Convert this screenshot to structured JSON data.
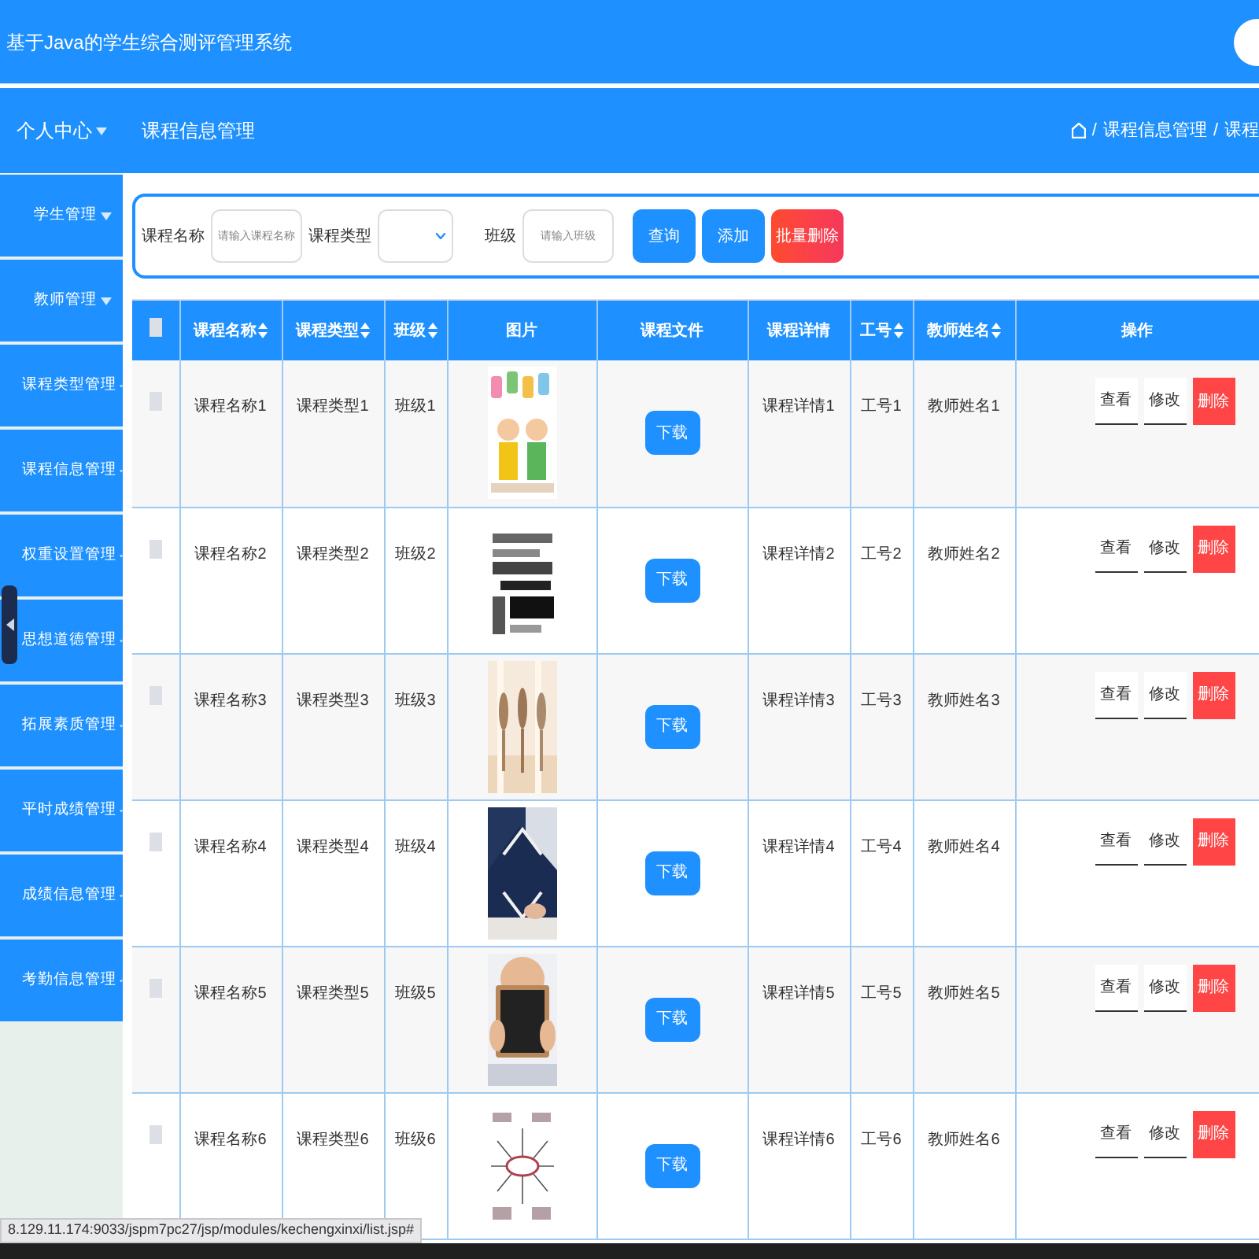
{
  "header": {
    "title": "基于Java的学生综合测评管理系统"
  },
  "nav": {
    "menu_label": "个人中心",
    "page_title": "课程信息管理",
    "breadcrumb": [
      {
        "separator": "/",
        "label": "课程信息管理"
      },
      {
        "separator": "/",
        "label": "课程"
      }
    ]
  },
  "sidebar": {
    "items": [
      {
        "label": "学生管理"
      },
      {
        "label": "教师管理"
      },
      {
        "label": "课程类型管理"
      },
      {
        "label": "课程信息管理"
      },
      {
        "label": "权重设置管理"
      },
      {
        "label": "思想道德管理"
      },
      {
        "label": "拓展素质管理"
      },
      {
        "label": "平时成绩管理"
      },
      {
        "label": "成绩信息管理"
      },
      {
        "label": "考勤信息管理"
      }
    ]
  },
  "search": {
    "fields": [
      {
        "kind": "input",
        "label": "课程名称",
        "placeholder": "请输入课程名称"
      },
      {
        "kind": "select",
        "label": "课程类型"
      },
      {
        "kind": "input",
        "label": "班级",
        "placeholder": "请输入班级"
      }
    ],
    "buttons": [
      {
        "label": "查询",
        "kind": "primary"
      },
      {
        "label": "添加",
        "kind": "primary"
      },
      {
        "label": "批量删除",
        "kind": "danger"
      }
    ]
  },
  "table": {
    "select_all": {
      "checked": false
    },
    "columns": [
      {
        "label": "课程名称",
        "sortable": true
      },
      {
        "label": "课程类型",
        "sortable": true
      },
      {
        "label": "班级",
        "sortable": true
      },
      {
        "label": "图片",
        "sortable": false
      },
      {
        "label": "课程文件",
        "sortable": false
      },
      {
        "label": "课程详情",
        "sortable": false
      },
      {
        "label": "工号",
        "sortable": true
      },
      {
        "label": "教师姓名",
        "sortable": true
      },
      {
        "label": "操作",
        "sortable": false
      }
    ],
    "rows": [
      {
        "checked": false,
        "cells": [
          "课程名称1",
          "课程类型1",
          "班级1"
        ],
        "file_button": "下载",
        "details": [
          "课程详情1",
          "工号1",
          "教师姓名1"
        ],
        "actions": [
          "查看",
          "修改",
          "删除"
        ]
      },
      {
        "checked": false,
        "cells": [
          "课程名称2",
          "课程类型2",
          "班级2"
        ],
        "file_button": "下载",
        "details": [
          "课程详情2",
          "工号2",
          "教师姓名2"
        ],
        "actions": [
          "查看",
          "修改",
          "删除"
        ]
      },
      {
        "checked": false,
        "cells": [
          "课程名称3",
          "课程类型3",
          "班级3"
        ],
        "file_button": "下载",
        "details": [
          "课程详情3",
          "工号3",
          "教师姓名3"
        ],
        "actions": [
          "查看",
          "修改",
          "删除"
        ]
      },
      {
        "checked": false,
        "cells": [
          "课程名称4",
          "课程类型4",
          "班级4"
        ],
        "file_button": "下载",
        "details": [
          "课程详情4",
          "工号4",
          "教师姓名4"
        ],
        "actions": [
          "查看",
          "修改",
          "删除"
        ]
      },
      {
        "checked": false,
        "cells": [
          "课程名称5",
          "课程类型5",
          "班级5"
        ],
        "file_button": "下载",
        "details": [
          "课程详情5",
          "工号5",
          "教师姓名5"
        ],
        "actions": [
          "查看",
          "修改",
          "删除"
        ]
      },
      {
        "checked": false,
        "cells": [
          "课程名称6",
          "课程类型6",
          "班级6"
        ],
        "file_button": "下载",
        "details": [
          "课程详情6",
          "工号6",
          "教师姓名6"
        ],
        "actions": [
          "查看",
          "修改",
          "删除"
        ]
      }
    ]
  },
  "status_url": "8.129.11.174:9033/jspm7pc27/jsp/modules/kechengxinxi/list.jsp#"
}
